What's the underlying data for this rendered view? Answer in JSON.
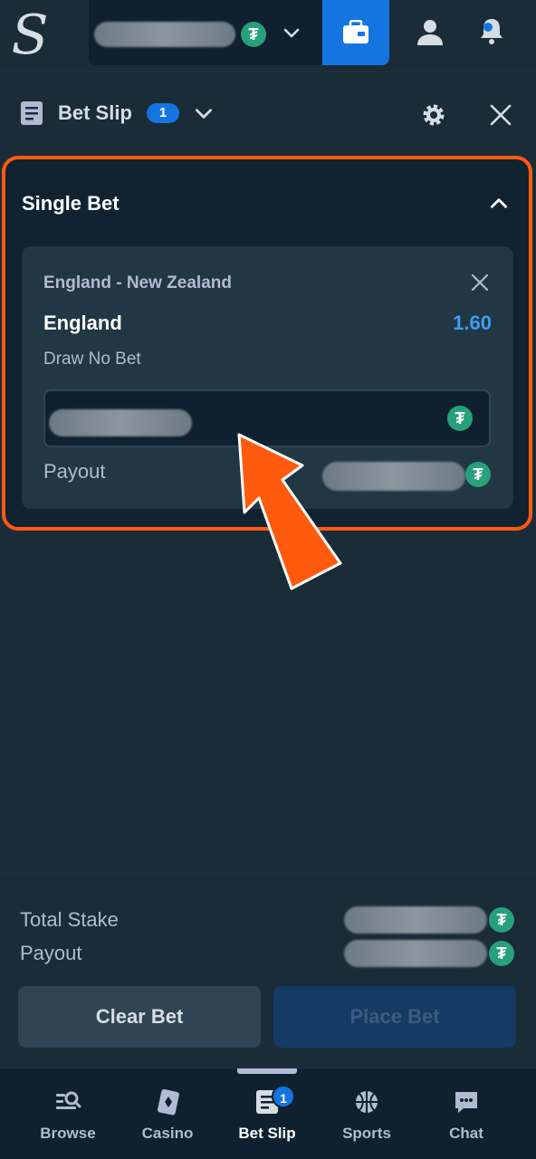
{
  "header": {
    "logo": "S",
    "currency_symbol": "₮"
  },
  "bet_slip": {
    "title": "Bet Slip",
    "count": "1"
  },
  "single_bet": {
    "title": "Single Bet",
    "match": "England - New Zealand",
    "selection": "England",
    "odds": "1.60",
    "market": "Draw No Bet",
    "payout_label": "Payout"
  },
  "summary": {
    "total_stake_label": "Total Stake",
    "payout_label": "Payout"
  },
  "actions": {
    "clear_label": "Clear Bet",
    "place_label": "Place Bet"
  },
  "bottom_nav": {
    "items": [
      {
        "label": "Browse",
        "icon": "browse-icon"
      },
      {
        "label": "Casino",
        "icon": "casino-icon"
      },
      {
        "label": "Bet Slip",
        "icon": "betslip-icon",
        "badge": "1"
      },
      {
        "label": "Sports",
        "icon": "basketball-icon"
      },
      {
        "label": "Chat",
        "icon": "chat-icon"
      }
    ]
  },
  "colors": {
    "background": "#1a2c38",
    "accent_blue": "#1475e1",
    "odds_blue": "#3c9ef5",
    "highlight_orange": "#ff5a0e",
    "tether_green": "#26a17b"
  }
}
